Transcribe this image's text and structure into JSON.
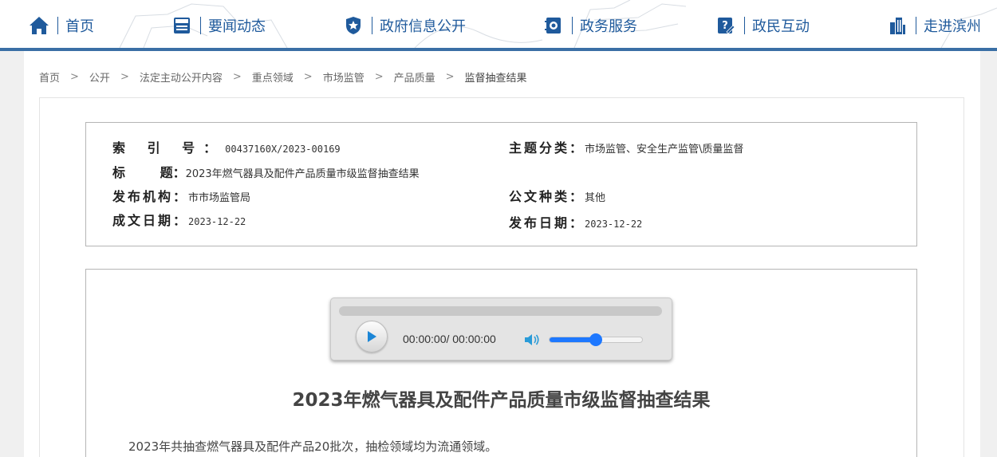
{
  "nav": {
    "items": [
      {
        "label": "首页",
        "icon": "home-icon"
      },
      {
        "label": "要闻动态",
        "icon": "news-icon"
      },
      {
        "label": "政府信息公开",
        "icon": "shield-star-icon"
      },
      {
        "label": "政务服务",
        "icon": "service-icon"
      },
      {
        "label": "政民互动",
        "icon": "question-edit-icon"
      },
      {
        "label": "走进滨州",
        "icon": "building-icon"
      }
    ],
    "accent": "#1f5a9c",
    "bar_color": "#3a6fa5"
  },
  "breadcrumb": {
    "items": [
      "首页",
      "公开",
      "法定主动公开内容",
      "重点领域",
      "市场监管",
      "产品质量",
      "监督抽查结果"
    ],
    "separator": ">"
  },
  "meta": {
    "index_no": {
      "key": "索 引 号：",
      "value": "00437160X/2023-00169"
    },
    "title": {
      "key": "标 题：",
      "value": "2023年燃气器具及配件产品质量市级监督抽查结果"
    },
    "publisher": {
      "key": "发布机构：",
      "value": "市市场监管局"
    },
    "created_date": {
      "key": "成文日期：",
      "value": "2023-12-22"
    },
    "subject": {
      "key": "主题分类：",
      "value": "市场监管、安全生产监管\\质量监督"
    },
    "doc_type": {
      "key": "公文种类：",
      "value": "其他"
    },
    "publish_date": {
      "key": "发布日期：",
      "value": "2023-12-22"
    }
  },
  "player": {
    "time": "00:00:00/ 00:00:00",
    "progress": 0,
    "volume": 0.5,
    "accent": "#1e78ff"
  },
  "article": {
    "title": "2023年燃气器具及配件产品质量市级监督抽查结果",
    "paragraph": "2023年共抽查燃气器具及配件产品20批次，抽检领域均为流通领域。"
  }
}
